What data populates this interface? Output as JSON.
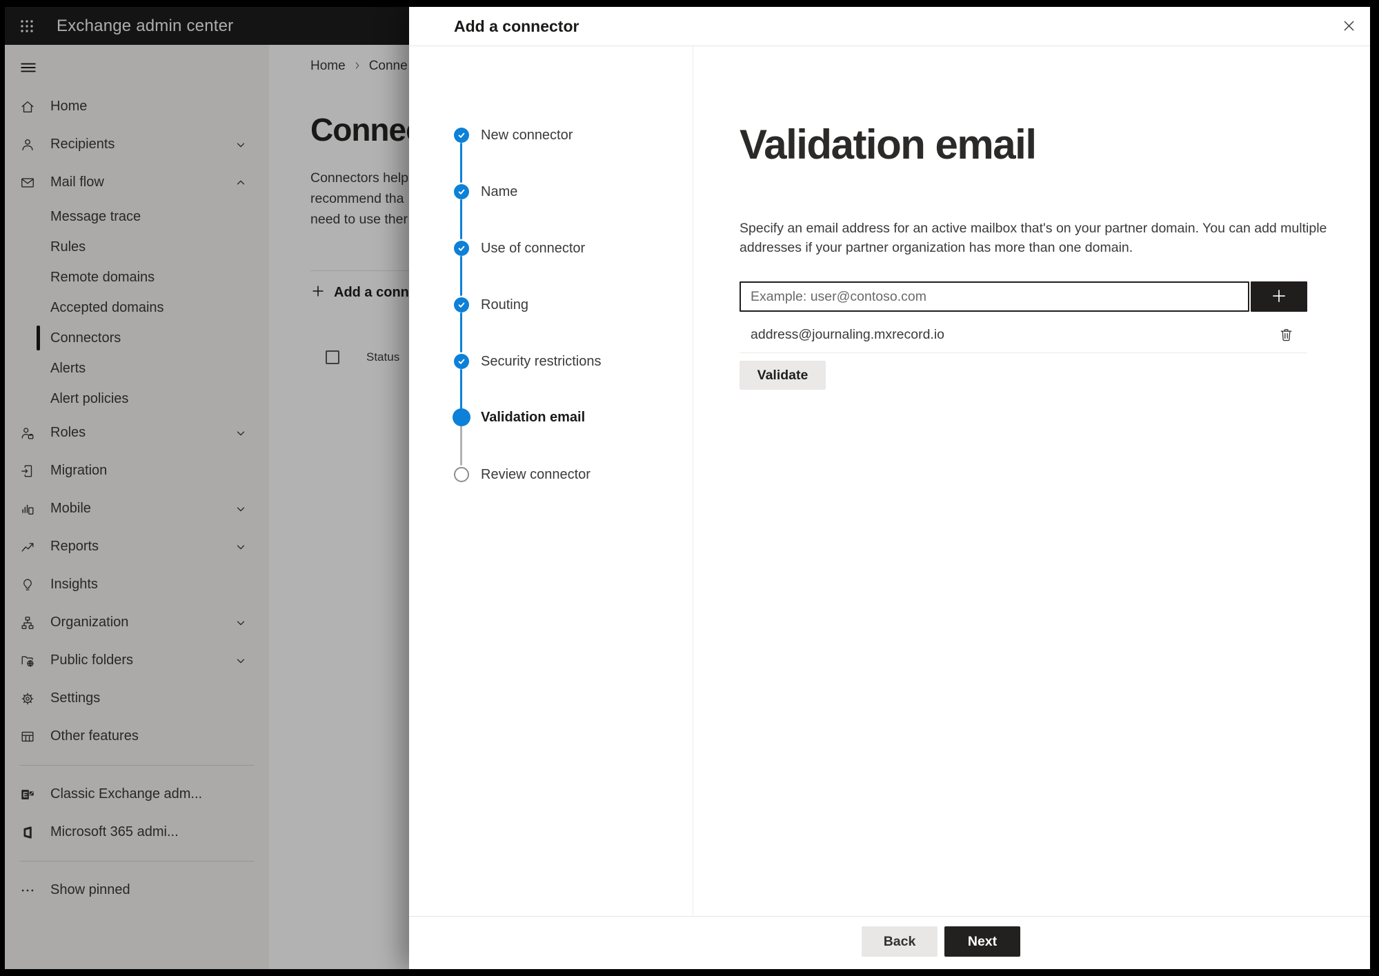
{
  "topbar": {
    "title": "Exchange admin center"
  },
  "sidebar": {
    "items": [
      {
        "label": "Home",
        "icon": "home-icon"
      },
      {
        "label": "Recipients",
        "icon": "person-icon",
        "chevron": "down"
      },
      {
        "label": "Mail flow",
        "icon": "mail-icon",
        "chevron": "up",
        "expanded": true
      },
      {
        "label": "Message trace",
        "indent": true
      },
      {
        "label": "Rules",
        "indent": true
      },
      {
        "label": "Remote domains",
        "indent": true
      },
      {
        "label": "Accepted domains",
        "indent": true
      },
      {
        "label": "Connectors",
        "indent": true,
        "selected": true
      },
      {
        "label": "Alerts",
        "indent": true
      },
      {
        "label": "Alert policies",
        "indent": true
      },
      {
        "label": "Roles",
        "icon": "roles-icon",
        "chevron": "down"
      },
      {
        "label": "Migration",
        "icon": "migration-icon"
      },
      {
        "label": "Mobile",
        "icon": "mobile-icon",
        "chevron": "down"
      },
      {
        "label": "Reports",
        "icon": "reports-icon",
        "chevron": "down"
      },
      {
        "label": "Insights",
        "icon": "insights-icon"
      },
      {
        "label": "Organization",
        "icon": "organization-icon",
        "chevron": "down"
      },
      {
        "label": "Public folders",
        "icon": "public-folders-icon",
        "chevron": "down"
      },
      {
        "label": "Settings",
        "icon": "settings-icon"
      },
      {
        "label": "Other features",
        "icon": "other-features-icon"
      }
    ],
    "footer_items": [
      {
        "label": "Classic Exchange adm...",
        "icon": "classic-exchange-icon"
      },
      {
        "label": "Microsoft 365 admi...",
        "icon": "microsoft-365-icon"
      }
    ],
    "show_pinned": {
      "label": "Show pinned",
      "icon": "ellipsis-icon"
    }
  },
  "page": {
    "breadcrumb": {
      "home": "Home",
      "current": "Conne"
    },
    "title": "Connect",
    "intro_lines": [
      "Connectors help",
      "recommend tha",
      "need to use ther"
    ],
    "add_button": "Add a conn",
    "table": {
      "status_header": "Status"
    }
  },
  "dialog": {
    "title": "Add a connector",
    "steps": [
      {
        "label": "New connector",
        "state": "complete"
      },
      {
        "label": "Name",
        "state": "complete"
      },
      {
        "label": "Use of connector",
        "state": "complete"
      },
      {
        "label": "Routing",
        "state": "complete"
      },
      {
        "label": "Security restrictions",
        "state": "complete"
      },
      {
        "label": "Validation email",
        "state": "current"
      },
      {
        "label": "Review connector",
        "state": "upcoming"
      }
    ],
    "content": {
      "heading": "Validation email",
      "description": "Specify an email address for an active mailbox that's on your partner domain. You can add multiple addresses if your partner organization has more than one domain.",
      "email_input": {
        "value": "",
        "placeholder": "Example: user@contoso.com"
      },
      "addresses": [
        {
          "email": "address@journaling.mxrecord.io"
        }
      ],
      "validate_button": "Validate"
    },
    "footer": {
      "back_button": "Back",
      "next_button": "Next"
    }
  },
  "colors": {
    "accent_blue": "#0d80d8",
    "topbar_bg": "#1e1e1e",
    "sidebar_bg": "#f5f4f2",
    "primary_button_bg": "#222120",
    "input_border": "#1f1e1d"
  }
}
